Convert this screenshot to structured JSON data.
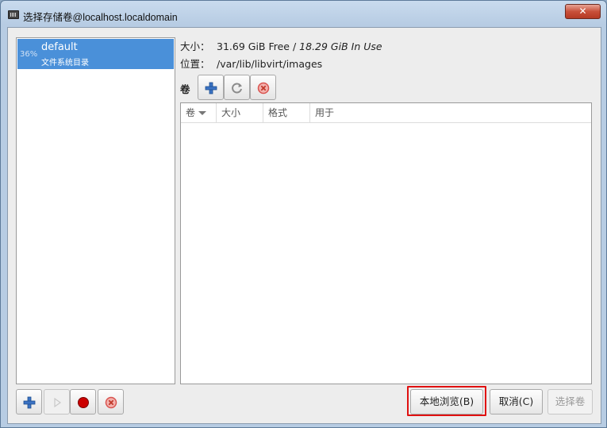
{
  "window": {
    "title": "选择存储卷@localhost.localdomain",
    "close_label": "✕"
  },
  "pools": [
    {
      "usage": "36%",
      "name": "default",
      "type": "文件系统目录",
      "selected": true
    }
  ],
  "info": {
    "size_label": "大小：",
    "size_free": "31.69 GiB Free /",
    "size_in_use": "18.29 GiB In Use",
    "location_label": "位置：",
    "location_value": "/var/lib/libvirt/images"
  },
  "volumes": {
    "section_label": "卷",
    "columns": [
      "卷",
      "大小",
      "格式",
      "用于"
    ],
    "rows": []
  },
  "buttons": {
    "browse_local": "本地浏览(B)",
    "cancel": "取消(C)",
    "choose_volume": "选择卷"
  },
  "colors": {
    "selection": "#4a90d9",
    "highlight_box": "#e01010",
    "add_icon": "#3b73c4",
    "record_icon": "#cc0000",
    "delete_icon": "#d9534f"
  }
}
